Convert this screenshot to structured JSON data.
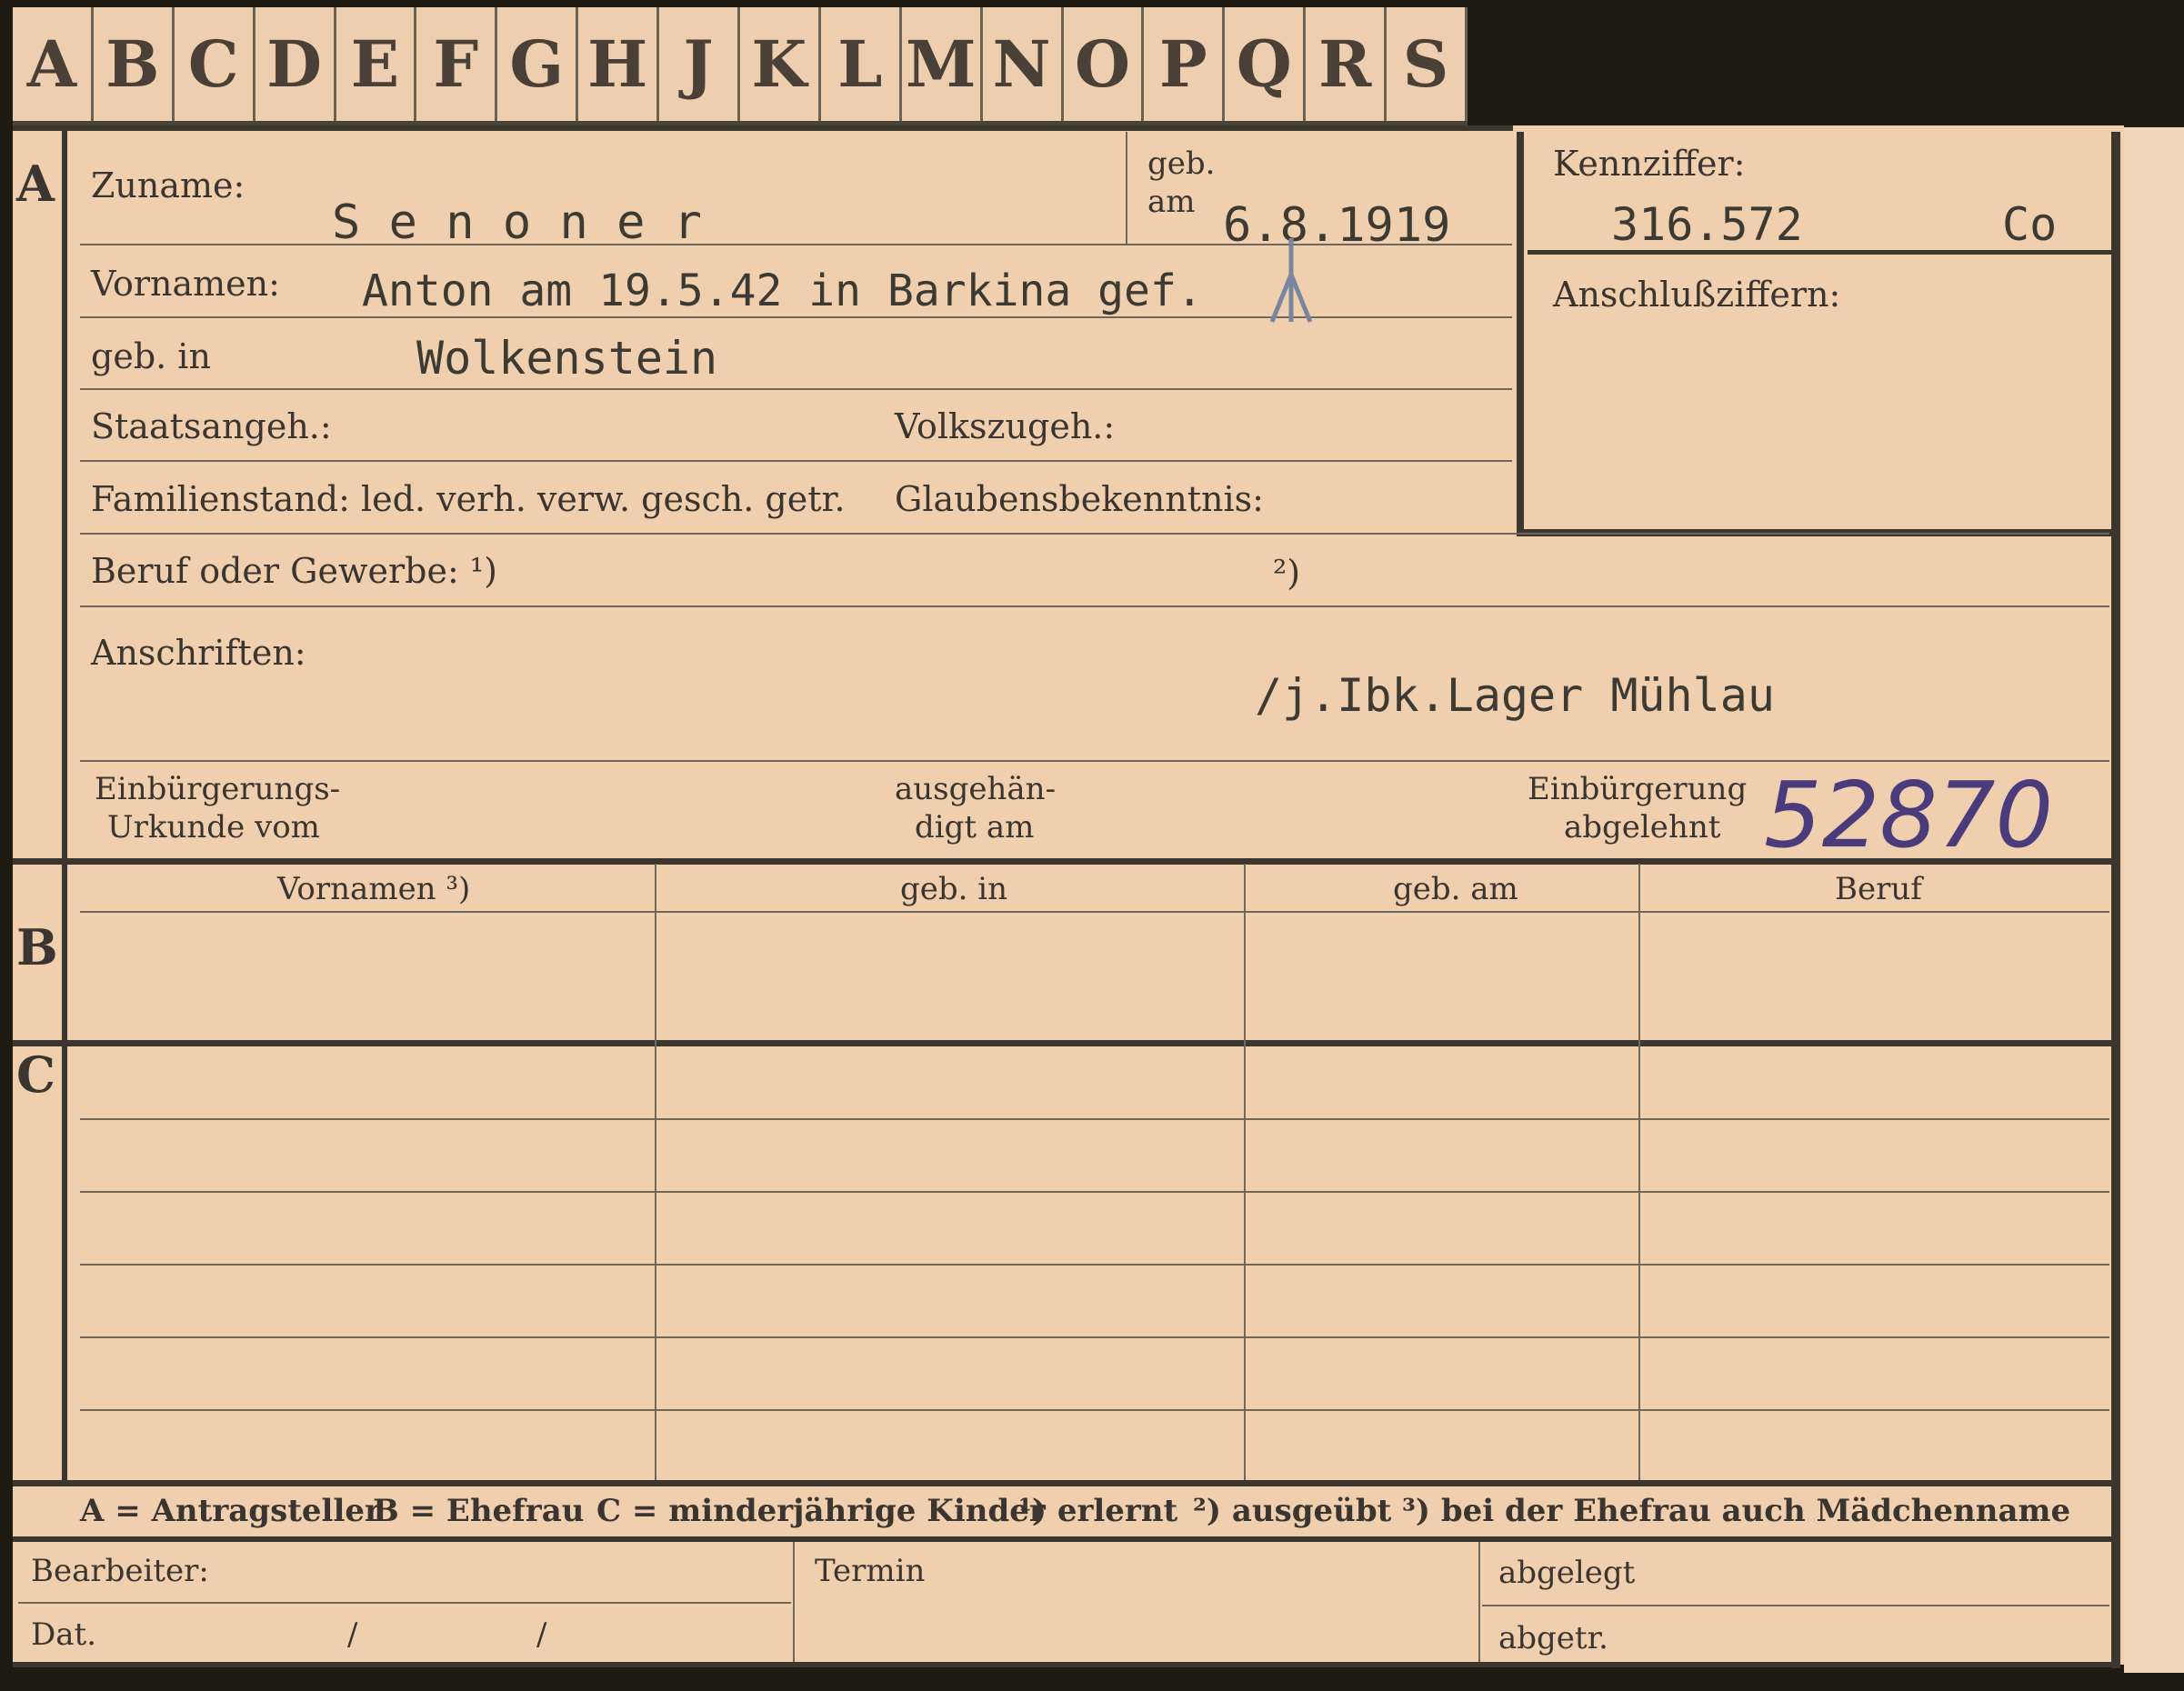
{
  "tabs": [
    "A",
    "B",
    "C",
    "D",
    "E",
    "F",
    "G",
    "H",
    "J",
    "K",
    "L",
    "M",
    "N",
    "O",
    "P",
    "Q",
    "R",
    "S"
  ],
  "sections": {
    "a": "A",
    "b": "B",
    "c": "C"
  },
  "labels": {
    "zuname": "Zuname:",
    "geb": "geb.",
    "am": "am",
    "vornamen": "Vornamen:",
    "geb_in": "geb. in",
    "staatsangeh": "Staatsangeh.:",
    "volkszugeh": "Volkszugeh.:",
    "familienstand": "Familienstand: led. verh. verw. gesch. getr.",
    "glaubensbekenntnis": "Glaubensbekenntnis:",
    "beruf_oder_gewerbe": "Beruf oder Gewerbe: ¹)",
    "beruf_note2": "²)",
    "anschriften": "Anschriften:",
    "einbuergerungs_line1": "Einbürgerungs-",
    "einbuergerungs_line2": "Urkunde vom",
    "ausgehaen_line1": "ausgehän-",
    "ausgehaen_line2": "digt am",
    "einbuergerung_line1": "Einbürgerung",
    "einbuergerung_line2": "abgelehnt",
    "kennziffer": "Kennziffer:",
    "anschlussziffern": "Anschlußziffern:"
  },
  "fields": {
    "surname": "S e n o n e r",
    "birth_date": "6.8.1919",
    "given_names": "Anton am 19.5.42 in Barkina gef.",
    "birthplace": "Wolkenstein",
    "address": "/j.Ibk.Lager Mühlau",
    "kennziffer_value": "316.572",
    "kennziffer_suffix": "Co",
    "handwritten_number": "52870"
  },
  "table": {
    "headers": [
      "Vornamen ³)",
      "geb. in",
      "geb. am",
      "Beruf"
    ]
  },
  "legend": {
    "a": "A = Antragsteller",
    "b": "B = Ehefrau",
    "c": "C = minderjährige Kinder",
    "n1": "¹) erlernt",
    "n2": "²) ausgeübt",
    "n3": "³) bei der Ehefrau auch Mädchenname"
  },
  "footer": {
    "bearbeiter": "Bearbeiter:",
    "dat": "Dat.",
    "slash1": "/",
    "slash2": "/",
    "termin": "Termin",
    "abgelegt": "abgelegt",
    "abgetr": "abgetr."
  }
}
